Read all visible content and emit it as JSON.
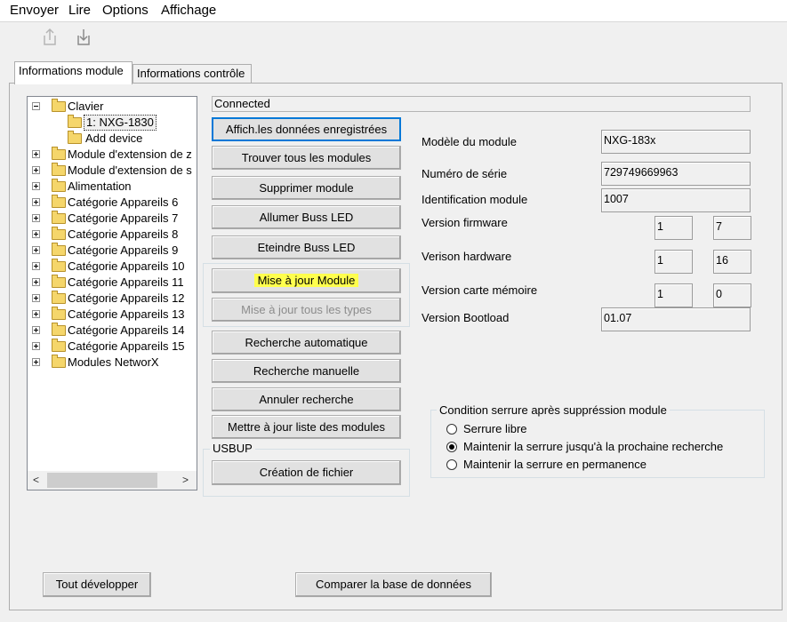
{
  "menu": [
    "Envoyer",
    "Lire",
    "Options",
    "Affichage"
  ],
  "toolbar": {
    "upload_icon": "upload-icon",
    "download_icon": "download-icon"
  },
  "tabs": [
    {
      "label": "Informations module",
      "active": true
    },
    {
      "label": "Informations contrôle",
      "active": false
    }
  ],
  "tree": {
    "items": [
      {
        "label": "Clavier",
        "expanded": true
      },
      {
        "label": "1: NXG-1830",
        "selected": true
      },
      {
        "label": "Add device"
      },
      {
        "label": "Module d'extension de z"
      },
      {
        "label": "Module d'extension de s"
      },
      {
        "label": "Alimentation"
      },
      {
        "label": "Catégorie Appareils 6"
      },
      {
        "label": "Catégorie Appareils 7"
      },
      {
        "label": "Catégorie Appareils 8"
      },
      {
        "label": "Catégorie Appareils 9"
      },
      {
        "label": "Catégorie Appareils 10"
      },
      {
        "label": "Catégorie Appareils 11"
      },
      {
        "label": "Catégorie Appareils 12"
      },
      {
        "label": "Catégorie Appareils 13"
      },
      {
        "label": "Catégorie Appareils 14"
      },
      {
        "label": "Catégorie Appareils 15"
      },
      {
        "label": "Modules NetworX"
      }
    ],
    "scroll_left": "<",
    "scroll_right": ">"
  },
  "status": "Connected",
  "buttons": {
    "show_saved": "Affich.les données enregistrées",
    "find_all": "Trouver tous les modules",
    "delete_module": "Supprimer module",
    "buss_led_on": "Allumer Buss LED",
    "buss_led_off": "Eteindre Buss LED",
    "update_module": "Mise à jour Module",
    "update_all_types": "Mise à jour tous les types",
    "auto_search": "Recherche automatique",
    "manual_search": "Recherche manuelle",
    "cancel_search": "Annuler recherche",
    "update_list": "Mettre à jour liste des modules",
    "create_file": "Création de fichier",
    "expand_all": "Tout développer",
    "compare_db": "Comparer la base de données"
  },
  "usbup": {
    "title": "USBUP"
  },
  "info": {
    "model_label": "Modèle du module",
    "model_value": "NXG-183x",
    "serial_label": "Numéro de série",
    "serial_value": "729749669963",
    "ident_label": "Identification module",
    "ident_value": "1007",
    "fw_label": "Version firmware",
    "fw_major": "1",
    "fw_minor": "7",
    "hw_label": "Verison hardware",
    "hw_major": "1",
    "hw_minor": "16",
    "mem_label": "Version carte mémoire",
    "mem_major": "1",
    "mem_minor": "0",
    "boot_label": "Version Bootload",
    "boot_value": "01.07"
  },
  "lock": {
    "title": "Condition serrure après suppréssion module",
    "options": [
      {
        "label": "Serrure libre",
        "checked": false
      },
      {
        "label": "Maintenir la serrure jusqu'à la prochaine recherche",
        "checked": true
      },
      {
        "label": "Maintenir la serrure en permanence",
        "checked": false
      }
    ]
  },
  "colors": {
    "highlight": "#ffff4d",
    "default_button_border": "#0078d7",
    "folder": "#f5d66b"
  }
}
